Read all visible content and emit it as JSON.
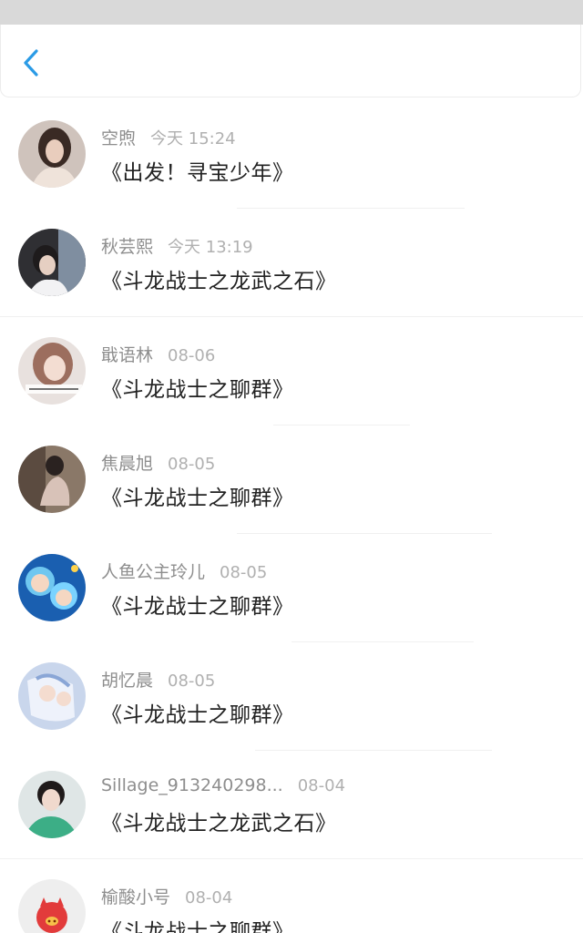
{
  "nav": {
    "back_icon": "chevron-left-icon",
    "accent": "#2b9be6"
  },
  "items": [
    {
      "name": "空煦",
      "time": "今天 15:24",
      "title": "《出发！寻宝少年》"
    },
    {
      "name": "秋芸熙",
      "time": "今天 13:19",
      "title": "《斗龙战士之龙武之石》"
    },
    {
      "name": "戢语林",
      "time": "08-06",
      "title": "《斗龙战士之聊群》"
    },
    {
      "name": "焦晨旭",
      "time": "08-05",
      "title": "《斗龙战士之聊群》"
    },
    {
      "name": "人鱼公主玲儿",
      "time": "08-05",
      "title": "《斗龙战士之聊群》"
    },
    {
      "name": "胡忆晨",
      "time": "08-05",
      "title": "《斗龙战士之聊群》"
    },
    {
      "name": "Sillage_913240298...",
      "time": "08-04",
      "title": "《斗龙战士之龙武之石》"
    },
    {
      "name": "榆酸小号",
      "time": "08-04",
      "title": "《斗龙战士之聊群》"
    }
  ]
}
